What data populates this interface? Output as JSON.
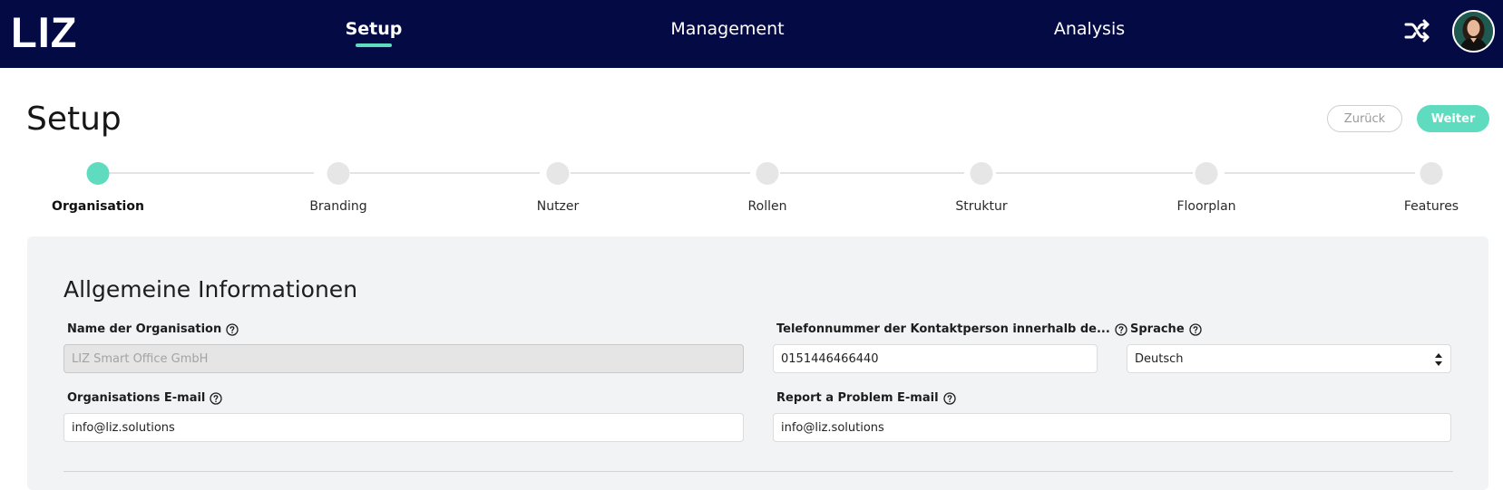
{
  "brand": {
    "logo_text": "LIZ",
    "navbar_color": "#040b44",
    "accent": "#5fdcc0"
  },
  "nav": {
    "tabs": [
      {
        "label": "Setup",
        "active": true
      },
      {
        "label": "Management",
        "active": false
      },
      {
        "label": "Analysis",
        "active": false
      }
    ],
    "icons": {
      "shuffle": "shuffle-icon",
      "avatar": "user-avatar"
    }
  },
  "header": {
    "title": "Setup",
    "back_label": "Zurück",
    "next_label": "Weiter"
  },
  "stepper": {
    "steps": [
      {
        "label": "Organisation",
        "active": true
      },
      {
        "label": "Branding",
        "active": false
      },
      {
        "label": "Nutzer",
        "active": false
      },
      {
        "label": "Rollen",
        "active": false
      },
      {
        "label": "Struktur",
        "active": false
      },
      {
        "label": "Floorplan",
        "active": false
      },
      {
        "label": "Features",
        "active": false
      }
    ]
  },
  "form": {
    "section_title": "Allgemeine Informationen",
    "fields": {
      "org_name": {
        "label": "Name der Organisation",
        "value": "LIZ Smart Office GmbH",
        "disabled": true
      },
      "phone": {
        "label": "Telefonnummer der Kontaktperson innerhalb de...",
        "value": "0151446466440"
      },
      "language": {
        "label": "Sprache",
        "value": "Deutsch"
      },
      "org_email": {
        "label": "Organisations E-mail",
        "value": "info@liz.solutions"
      },
      "problem_email": {
        "label": "Report a Problem E-mail",
        "value": "info@liz.solutions"
      }
    }
  }
}
